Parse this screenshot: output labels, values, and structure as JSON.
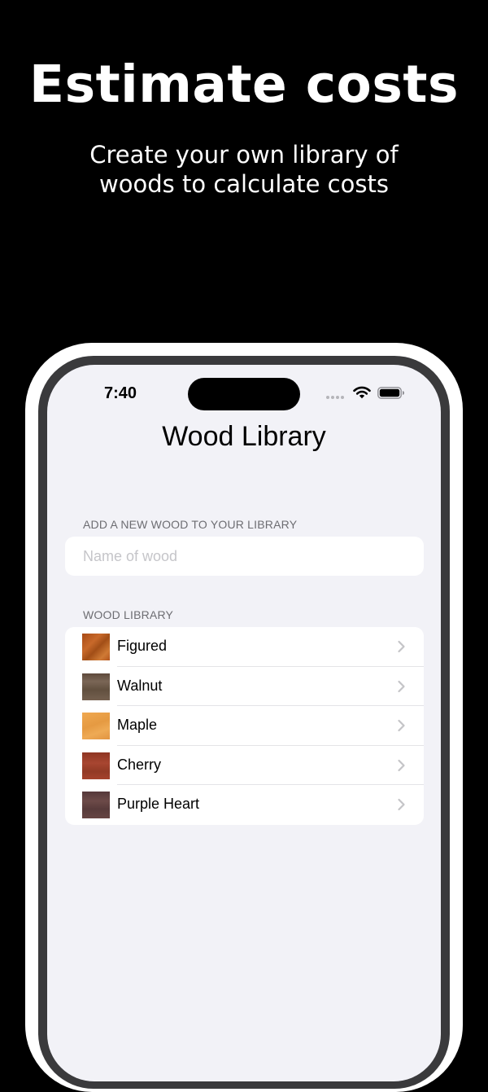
{
  "promo": {
    "headline": "Estimate costs",
    "subhead_line1": "Create your own library of",
    "subhead_line2": "woods to calculate costs"
  },
  "status_bar": {
    "time": "7:40",
    "icons": [
      "signal-dots-icon",
      "wifi-icon",
      "battery-icon"
    ]
  },
  "nav": {
    "title": "Wood Library"
  },
  "add_section": {
    "header": "ADD A NEW WOOD TO YOUR LIBRARY",
    "input_value": "",
    "input_placeholder": "Name of wood"
  },
  "library_section": {
    "header": "WOOD LIBRARY",
    "items": [
      {
        "label": "Figured",
        "swatch_color": "#b4581c",
        "icon": "chevron-right-icon"
      },
      {
        "label": "Walnut",
        "swatch_color": "#6b5747",
        "icon": "chevron-right-icon"
      },
      {
        "label": "Maple",
        "swatch_color": "#e9a049",
        "icon": "chevron-right-icon"
      },
      {
        "label": "Cherry",
        "swatch_color": "#9a3d27",
        "icon": "chevron-right-icon"
      },
      {
        "label": "Purple Heart",
        "swatch_color": "#5f3f3d",
        "icon": "chevron-right-icon"
      }
    ]
  },
  "colors": {
    "page_background": "#000000",
    "screen_background": "#f2f2f7",
    "card_background": "#ffffff",
    "section_header_text": "#6d6d72",
    "placeholder_text": "#c5c5c9",
    "chevron": "#c4c4c7"
  }
}
